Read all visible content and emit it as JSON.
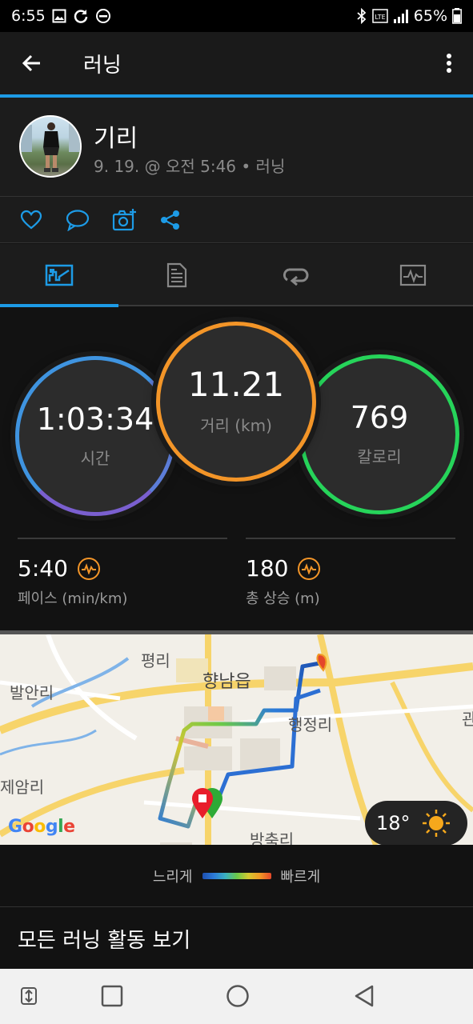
{
  "status_bar": {
    "time": "6:55",
    "battery": "65%",
    "icons": [
      "gallery-icon",
      "sync-icon",
      "dnd-icon",
      "bluetooth-icon",
      "lte-icon",
      "signal-icon",
      "battery-icon"
    ]
  },
  "app_bar": {
    "title": "러닝",
    "back_icon": "arrow-left-icon",
    "more_icon": "more-vertical-icon"
  },
  "profile": {
    "name": "기리",
    "meta": "9. 19. @ 오전 5:46 • 러닝"
  },
  "actions": [
    "like-icon",
    "comment-icon",
    "add-photo-icon",
    "share-icon"
  ],
  "tabs": [
    {
      "name": "overview",
      "icon": "chart-icon",
      "active": true
    },
    {
      "name": "details",
      "icon": "document-icon",
      "active": false
    },
    {
      "name": "laps",
      "icon": "laps-icon",
      "active": false
    },
    {
      "name": "graphs",
      "icon": "graph-icon",
      "active": false
    }
  ],
  "stats": {
    "time": {
      "value": "1:03:34",
      "label": "시간"
    },
    "distance": {
      "value": "11.21",
      "label": "거리 (km)"
    },
    "calories": {
      "value": "769",
      "label": "칼로리"
    },
    "pace": {
      "value": "5:40",
      "label": "페이스 (min/km)"
    },
    "ascent": {
      "value": "180",
      "label": "총 상승 (m)"
    }
  },
  "map": {
    "labels": [
      "평리",
      "향남읍",
      "발안리",
      "행정리",
      "제암리",
      "방축리",
      "관"
    ],
    "attribution": "Google",
    "weather": {
      "temp": "18°",
      "icon": "sun-icon"
    }
  },
  "legend": {
    "slow": "느리게",
    "fast": "빠르게"
  },
  "footer_link": "모든 러닝 활동 보기",
  "colors": {
    "accent": "#1d9be6",
    "time_ring": "#5c7dd8",
    "distance_ring": "#f39528",
    "calorie_ring": "#26d45a"
  }
}
